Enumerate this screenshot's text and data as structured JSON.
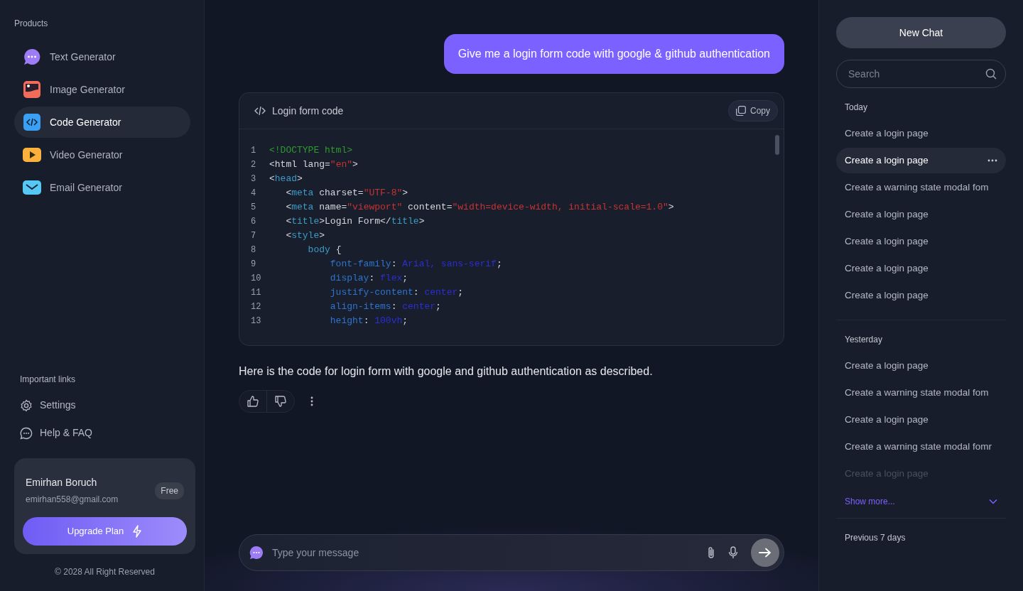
{
  "sidebar": {
    "products_heading": "Products",
    "products": [
      {
        "label": "Text Generator",
        "selected": false
      },
      {
        "label": "Image Generator",
        "selected": false
      },
      {
        "label": "Code Generator",
        "selected": true
      },
      {
        "label": "Video Generator",
        "selected": false
      },
      {
        "label": "Email Generator",
        "selected": false
      }
    ],
    "links_heading": "Important links",
    "links": [
      {
        "label": "Settings"
      },
      {
        "label": "Help & FAQ"
      }
    ],
    "user": {
      "name": "Emirhan Boruch",
      "email": "emirhan558@gmail.com",
      "plan": "Free",
      "upgrade": "Upgrade Plan"
    },
    "footer": "© 2028 All Right Reserved"
  },
  "chat": {
    "user_message": "Give me a login form code with google & github authentication",
    "code_block": {
      "title": "Login form code",
      "copy": "Copy",
      "lines": [
        {
          "n": "1",
          "segs": [
            {
              "kind": "doctype",
              "t": "<!DOCTYPE html>"
            }
          ]
        },
        {
          "n": "2",
          "segs": [
            {
              "kind": "plain",
              "t": "<html lang="
            },
            {
              "kind": "string",
              "t": "\"en\""
            },
            {
              "kind": "plain",
              "t": ">"
            }
          ]
        },
        {
          "n": "3",
          "segs": [
            {
              "kind": "plain",
              "t": "<"
            },
            {
              "kind": "tag",
              "t": "head"
            },
            {
              "kind": "plain",
              "t": ">"
            }
          ]
        },
        {
          "n": "4",
          "segs": [
            {
              "kind": "plain",
              "t": "   <"
            },
            {
              "kind": "tag",
              "t": "meta"
            },
            {
              "kind": "plain",
              "t": " charset="
            },
            {
              "kind": "string",
              "t": "\"UTF-8\""
            },
            {
              "kind": "plain",
              "t": ">"
            }
          ]
        },
        {
          "n": "5",
          "segs": [
            {
              "kind": "plain",
              "t": "   <"
            },
            {
              "kind": "tag",
              "t": "meta"
            },
            {
              "kind": "plain",
              "t": " name="
            },
            {
              "kind": "string",
              "t": "\"viewport\""
            },
            {
              "kind": "plain",
              "t": " content="
            },
            {
              "kind": "string",
              "t": "\"width=device-width, initial-scale=1.0\""
            },
            {
              "kind": "plain",
              "t": ">"
            }
          ]
        },
        {
          "n": "6",
          "segs": [
            {
              "kind": "plain",
              "t": "   <"
            },
            {
              "kind": "tag",
              "t": "title"
            },
            {
              "kind": "plain",
              "t": ">Login Form</"
            },
            {
              "kind": "tag",
              "t": "title"
            },
            {
              "kind": "plain",
              "t": ">"
            }
          ]
        },
        {
          "n": "7",
          "segs": [
            {
              "kind": "plain",
              "t": "   <"
            },
            {
              "kind": "tag",
              "t": "style"
            },
            {
              "kind": "plain",
              "t": ">"
            }
          ]
        },
        {
          "n": "8",
          "segs": [
            {
              "kind": "tag",
              "t": "       body"
            },
            {
              "kind": "plain",
              "t": " {"
            }
          ]
        },
        {
          "n": "9",
          "segs": [
            {
              "kind": "property",
              "t": "           font-family"
            },
            {
              "kind": "plain",
              "t": ": "
            },
            {
              "kind": "value",
              "t": "Arial, sans-serif"
            },
            {
              "kind": "plain",
              "t": ";"
            }
          ]
        },
        {
          "n": "10",
          "segs": [
            {
              "kind": "property",
              "t": "           display"
            },
            {
              "kind": "plain",
              "t": ": "
            },
            {
              "kind": "value",
              "t": "flex"
            },
            {
              "kind": "plain",
              "t": ";"
            }
          ]
        },
        {
          "n": "11",
          "segs": [
            {
              "kind": "property",
              "t": "           justify-content"
            },
            {
              "kind": "plain",
              "t": ": "
            },
            {
              "kind": "value",
              "t": "center"
            },
            {
              "kind": "plain",
              "t": ";"
            }
          ]
        },
        {
          "n": "12",
          "segs": [
            {
              "kind": "property",
              "t": "           align-items"
            },
            {
              "kind": "plain",
              "t": ": "
            },
            {
              "kind": "value",
              "t": "center"
            },
            {
              "kind": "plain",
              "t": ";"
            }
          ]
        },
        {
          "n": "13",
          "segs": [
            {
              "kind": "property",
              "t": "           height"
            },
            {
              "kind": "plain",
              "t": ": "
            },
            {
              "kind": "value",
              "t": "100vh"
            },
            {
              "kind": "plain",
              "t": ";"
            }
          ]
        }
      ]
    },
    "reply": "Here is the code for login form with google and github authentication as described.",
    "input": {
      "placeholder": "Type your message"
    }
  },
  "history": {
    "new_chat": "New Chat",
    "search": {
      "placeholder": "Search"
    },
    "groups": [
      {
        "title": "Today",
        "items": [
          {
            "label": "Create a login page",
            "selected": false,
            "dimmed": false
          },
          {
            "label": "Create a login page",
            "selected": true,
            "dimmed": false
          },
          {
            "label": "Create a warning state modal fom",
            "selected": false,
            "dimmed": false
          },
          {
            "label": "Create a login page",
            "selected": false,
            "dimmed": false
          },
          {
            "label": "Create a login page",
            "selected": false,
            "dimmed": false
          },
          {
            "label": "Create a login page",
            "selected": false,
            "dimmed": false
          },
          {
            "label": "Create a login page",
            "selected": false,
            "dimmed": false
          }
        ]
      },
      {
        "title": "Yesterday",
        "items": [
          {
            "label": "Create a login page",
            "selected": false,
            "dimmed": false
          },
          {
            "label": "Create a warning state modal fom",
            "selected": false,
            "dimmed": false
          },
          {
            "label": "Create a login page",
            "selected": false,
            "dimmed": false
          },
          {
            "label": "Create a warning state modal fomr",
            "selected": false,
            "dimmed": false
          },
          {
            "label": "Create a login page",
            "selected": false,
            "dimmed": true
          }
        ],
        "show_more": "Show more..."
      },
      {
        "title": "Previous 7 days"
      }
    ]
  }
}
